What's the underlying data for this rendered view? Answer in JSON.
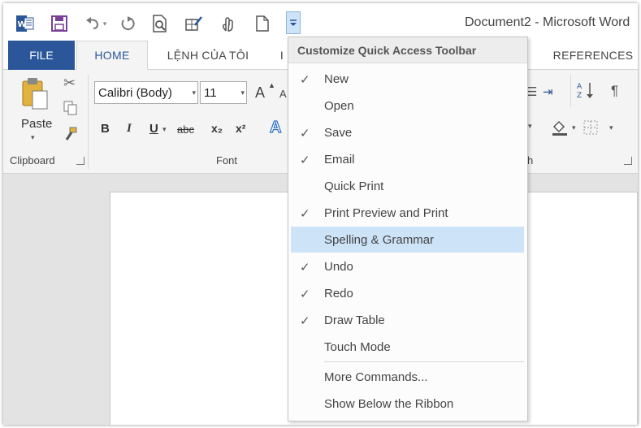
{
  "window": {
    "title": "Document2 - Microsoft Word"
  },
  "qat": {
    "icons": [
      "word-logo-icon",
      "save-icon",
      "undo-icon",
      "redo-icon",
      "print-preview-icon",
      "draw-table-icon",
      "touch-mode-icon",
      "new-document-icon",
      "customize-qat-icon"
    ]
  },
  "tabs": {
    "file": "FILE",
    "home": "HOME",
    "custom": "LỆNH CỦA TÔI",
    "insert_partial": "I",
    "references": "REFERENCES"
  },
  "ribbon": {
    "paste_label": "Paste",
    "clipboard_label": "Clipboard",
    "font_label": "Font",
    "paragraph_label_partial": "h",
    "font_name": "Calibri (Body)",
    "font_size": "11",
    "bold": "B",
    "italic": "I",
    "underline": "U",
    "strikethrough": "abc",
    "subscript": "x₂",
    "superscript": "x²",
    "text_effects": "A",
    "grow_font": "A",
    "shrink_font": "A"
  },
  "menu": {
    "header": "Customize Quick Access Toolbar",
    "items": [
      {
        "label": "New",
        "checked": true
      },
      {
        "label": "Open",
        "checked": false
      },
      {
        "label": "Save",
        "checked": true
      },
      {
        "label": "Email",
        "checked": true
      },
      {
        "label": "Quick Print",
        "checked": false
      },
      {
        "label": "Print Preview and Print",
        "checked": true
      },
      {
        "label": "Spelling & Grammar",
        "checked": false,
        "hover": true
      },
      {
        "label": "Undo",
        "checked": true
      },
      {
        "label": "Redo",
        "checked": true
      },
      {
        "label": "Draw Table",
        "checked": true
      },
      {
        "label": "Touch Mode",
        "checked": false
      }
    ],
    "more_commands": "More Commands...",
    "show_below": "Show Below the Ribbon",
    "check_glyph": "✓"
  },
  "colors": {
    "file_tab": "#2b579a",
    "word_blue": "#2b579a",
    "menu_hover": "#cde3f7"
  }
}
